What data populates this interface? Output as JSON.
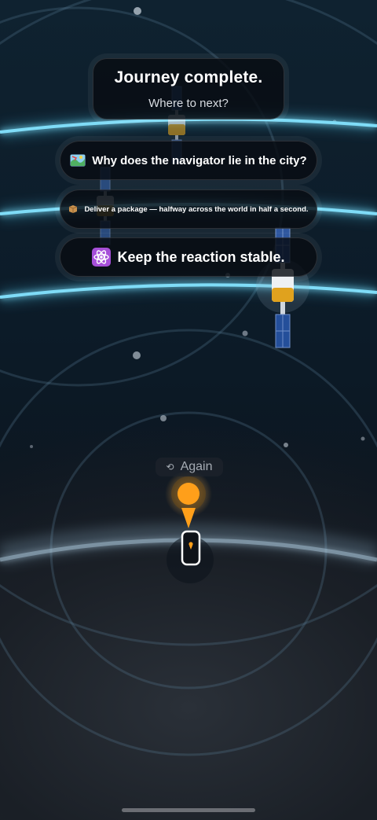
{
  "header": {
    "title": "Journey complete.",
    "subtitle": "Where to next?"
  },
  "choices": [
    {
      "icon": "map-icon",
      "label": "Why does the navigator lie in the city?"
    },
    {
      "icon": "package-icon",
      "label": "Deliver a package — halfway across the world in half a second."
    },
    {
      "icon": "atom-icon",
      "label": "Keep the reaction stable."
    }
  ],
  "again": {
    "icon": "replay-icon",
    "label": "Again"
  },
  "colors": {
    "orbit_glow": "#4cc9f0",
    "pin_orange": "#ff9f1a",
    "satellite_gold": "#e0a21e",
    "solar_panel": "#2a5aa8",
    "atom_purple": "#a64fd8"
  }
}
